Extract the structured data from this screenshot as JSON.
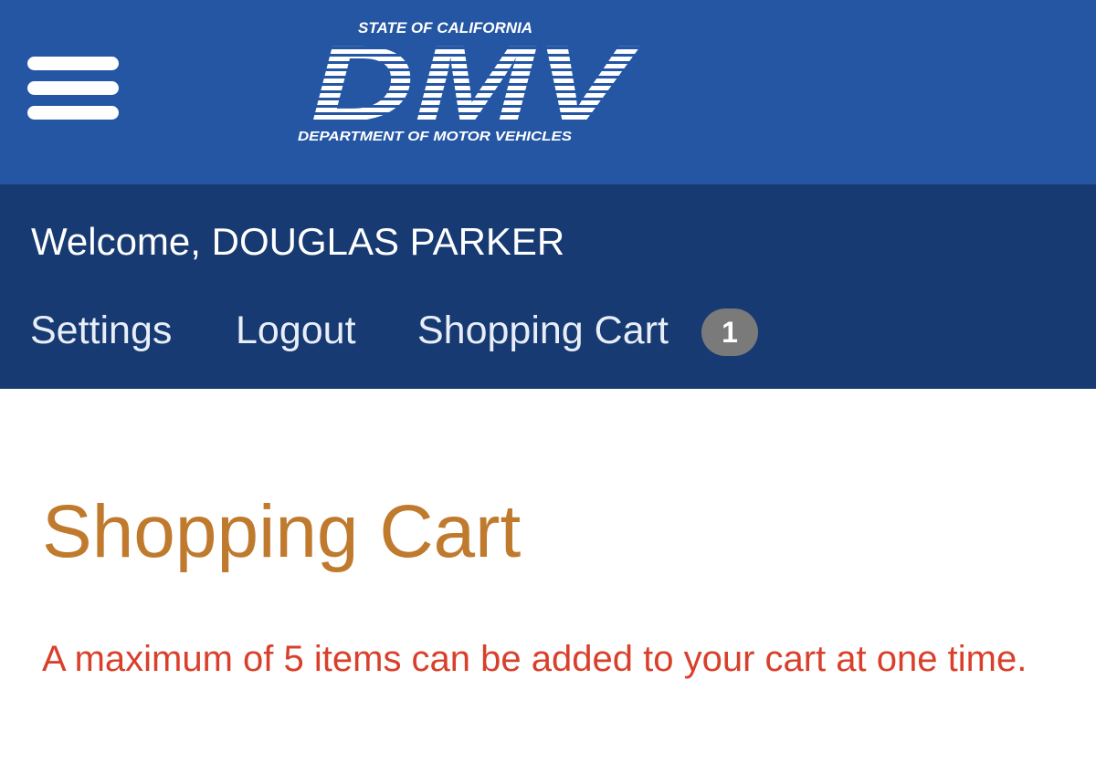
{
  "header": {
    "logo": {
      "top_text": "STATE OF CALIFORNIA",
      "main_text": "DMV",
      "bottom_text": "DEPARTMENT OF MOTOR VEHICLES"
    },
    "menu_icon": "hamburger-menu-icon"
  },
  "user_bar": {
    "welcome": "Welcome, DOUGLAS PARKER",
    "nav": {
      "settings": "Settings",
      "logout": "Logout",
      "cart": "Shopping Cart",
      "cart_count": "1"
    }
  },
  "main": {
    "title": "Shopping Cart",
    "notice": "A maximum of 5 items can be added to your cart at one time."
  },
  "colors": {
    "header_blue": "#2456a4",
    "userbar_navy": "#173a72",
    "title_orange": "#c07a2e",
    "notice_red": "#d9402b",
    "badge_gray": "#7a7a7a"
  }
}
